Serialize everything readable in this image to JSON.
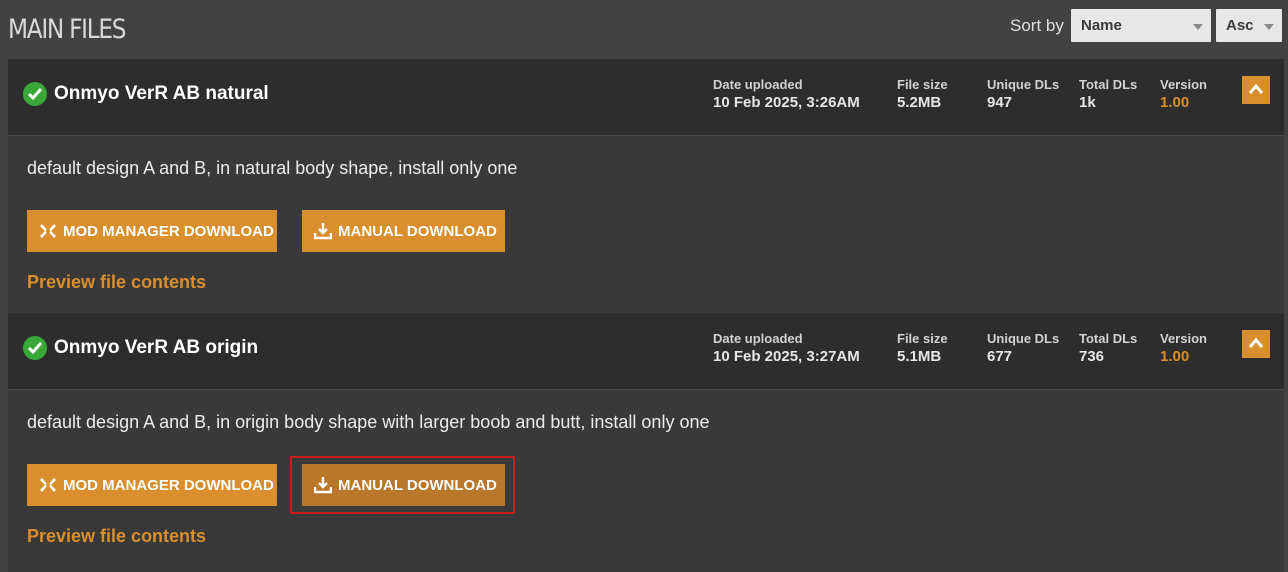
{
  "header": {
    "title": "MAIN FILES",
    "sort_label": "Sort by",
    "sort_value": "Name",
    "order_value": "Asc"
  },
  "stat_labels": {
    "date": "Date uploaded",
    "size": "File size",
    "unique": "Unique DLs",
    "total": "Total DLs",
    "version": "Version"
  },
  "buttons": {
    "mod_manager": "MOD MANAGER DOWNLOAD",
    "manual": "MANUAL DOWNLOAD",
    "preview": "Preview file contents"
  },
  "files": [
    {
      "name": "Onmyo VerR AB natural",
      "date": "10 Feb 2025, 3:26AM",
      "size": "5.2MB",
      "unique": "947",
      "total": "1k",
      "version": "1.00",
      "description": "default design A and B, in natural body shape, install only one"
    },
    {
      "name": "Onmyo VerR AB origin",
      "date": "10 Feb 2025, 3:27AM",
      "size": "5.1MB",
      "unique": "677",
      "total": "736",
      "version": "1.00",
      "description": "default design A and B, in origin body shape with larger boob and butt, install only one"
    }
  ],
  "colors": {
    "accent": "#d98f2d",
    "check": "#3aa839",
    "highlight": "#cc1b1b"
  }
}
